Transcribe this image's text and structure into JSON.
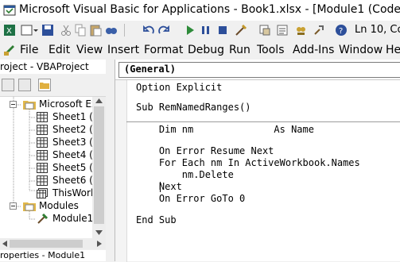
{
  "window": {
    "title": "Microsoft Visual Basic for Applications - Book1.xlsx - [Module1 (Code)]"
  },
  "toolbar": {
    "position_text": "Ln 10, Col"
  },
  "menu": {
    "items": [
      "File",
      "Edit",
      "View",
      "Insert",
      "Format",
      "Debug",
      "Run",
      "Tools",
      "Add-Ins",
      "Window",
      "He"
    ]
  },
  "project_pane": {
    "title": "roject - VBAProject",
    "tree": [
      {
        "label": "Microsoft Ex"
      },
      {
        "label": "Sheet1 ("
      },
      {
        "label": "Sheet2 ("
      },
      {
        "label": "Sheet3 ("
      },
      {
        "label": "Sheet4 ("
      },
      {
        "label": "Sheet5 ("
      },
      {
        "label": "Sheet6 ("
      },
      {
        "label": "ThisWork"
      },
      {
        "label": "Modules"
      },
      {
        "label": "Module1"
      }
    ]
  },
  "properties_pane": {
    "title": "roperties - Module1"
  },
  "code_window": {
    "object_combo": "(General)",
    "lines": [
      "Option Explicit",
      "",
      "Sub RemNamedRanges()",
      "",
      "    Dim nm              As Name",
      "",
      "    On Error Resume Next",
      "    For Each nm In ActiveWorkbook.Names",
      "        nm.Delete",
      "    Next",
      "    On Error GoTo 0",
      "",
      "End Sub"
    ]
  }
}
